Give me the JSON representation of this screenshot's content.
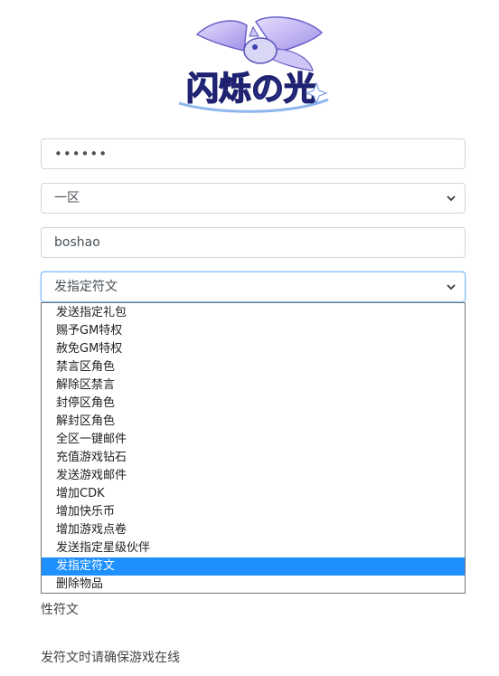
{
  "logo": {
    "alt_text": "闪烁の光",
    "colors": {
      "primary": "#4a4fc4",
      "accent": "#b9a6ef",
      "outline": "#2a2e8c"
    }
  },
  "form": {
    "password_value": "••••••",
    "server_select": {
      "selected": "一区"
    },
    "username_value": "boshao",
    "action_select": {
      "selected": "发指定符文"
    }
  },
  "dropdown": {
    "options": [
      "发送指定礼包",
      "赐予GM特权",
      "赦免GM特权",
      "禁言区角色",
      "解除区禁言",
      "封停区角色",
      "解封区角色",
      "全区一键邮件",
      "充值游戏钻石",
      "发送游戏邮件",
      "增加CDK",
      "增加快乐币",
      "增加游戏点卷",
      "发送指定星级伙伴",
      "发指定符文",
      "删除物品"
    ],
    "selected_index": 14,
    "highlight_color": "#1e90ff"
  },
  "below": {
    "partial_text": "性符文",
    "notice": "发符文时请确保游戏在线"
  }
}
